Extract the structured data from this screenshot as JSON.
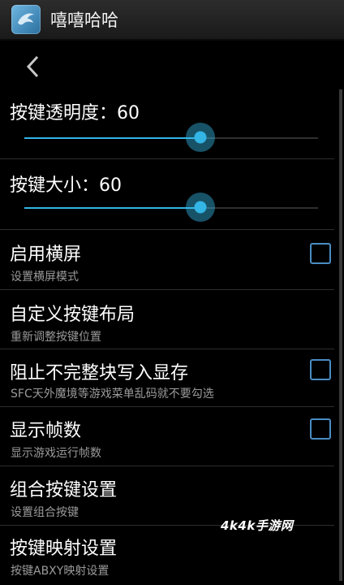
{
  "app": {
    "title": "嘻嘻哈哈",
    "icon": "dolphin-logo-icon"
  },
  "header": {
    "back_icon": "back-arrow-icon"
  },
  "settings": [
    {
      "type": "slider",
      "title": "按键透明度：60",
      "value": 60,
      "max": 100
    },
    {
      "type": "slider",
      "title": "按键大小：60",
      "value": 60,
      "max": 100
    },
    {
      "type": "checkbox",
      "title": "启用横屏",
      "summary": "设置横屏模式",
      "checked": false
    },
    {
      "type": "item",
      "title": "自定义按键布局",
      "summary": "重新调整按键位置"
    },
    {
      "type": "checkbox",
      "title": "阻止不完整块写入显存",
      "summary": "SFC天外魔境等游戏菜单乱码就不要勾选",
      "checked": false
    },
    {
      "type": "checkbox",
      "title": "显示帧数",
      "summary": "显示游戏运行帧数",
      "checked": false
    },
    {
      "type": "item",
      "title": "组合按键设置",
      "summary": "设置组合按键"
    },
    {
      "type": "item",
      "title": "按键映射设置",
      "summary": "按键ABXY映射设置"
    }
  ],
  "watermark": "4k4k手游网",
  "colors": {
    "accent": "#33b5e5",
    "checkbox_border": "#4a8cc2",
    "background": "#000000"
  }
}
